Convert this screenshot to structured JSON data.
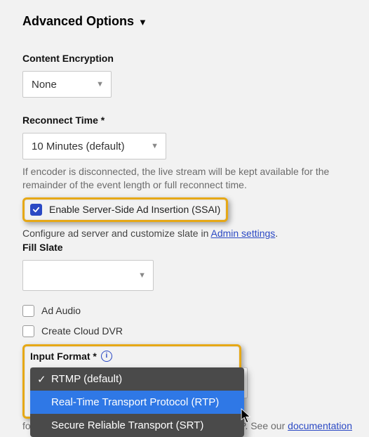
{
  "section": {
    "title": "Advanced Options"
  },
  "encryption": {
    "label": "Content Encryption",
    "value": "None"
  },
  "reconnect": {
    "label": "Reconnect Time *",
    "value": "10 Minutes (default)",
    "help": "If encoder is disconnected, the live stream will be kept available for the remainder of the event length or full reconnect time."
  },
  "ssai": {
    "label": "Enable Server-Side Ad Insertion (SSAI)",
    "checked": true,
    "config_text_pre": "Configure ad server and customize slate in ",
    "config_link": "Admin settings",
    "config_text_post": "."
  },
  "fill_slate": {
    "label": "Fill Slate",
    "value": ""
  },
  "ad_audio": {
    "label": "Ad Audio",
    "checked": false
  },
  "cloud_dvr": {
    "label": "Create Cloud DVR",
    "checked": false
  },
  "input_format": {
    "label": "Input Format *",
    "selected": "RTMP (default)",
    "options": [
      {
        "label": "RTMP (default)",
        "selected": true,
        "hover": false
      },
      {
        "label": "Real-Time Transport Protocol (RTP)",
        "selected": false,
        "hover": true
      },
      {
        "label": "Secure Reliable Transport (SRT)",
        "selected": false,
        "hover": false
      }
    ]
  },
  "footer": {
    "crumb": "for best practices.",
    "tail_pre": "CP. See our ",
    "tail_link": "documentation"
  }
}
